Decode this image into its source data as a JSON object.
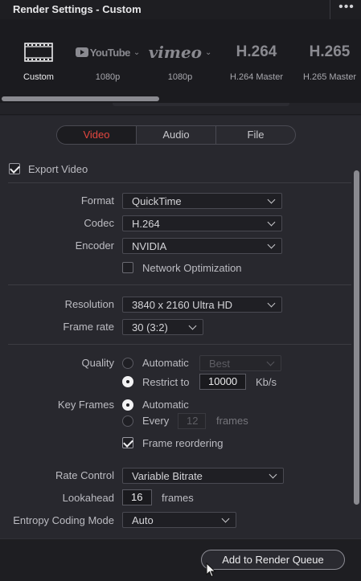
{
  "window": {
    "title": "Render Settings - Custom",
    "more_label": "•••"
  },
  "presets": [
    {
      "name": "Custom",
      "label": "Custom",
      "icon": "film-strip-icon",
      "active": true
    },
    {
      "name": "youtube",
      "label": "1080p",
      "logo": "YouTube",
      "icon": "youtube-logo"
    },
    {
      "name": "vimeo",
      "label": "1080p",
      "logo": "vimeo",
      "icon": "vimeo-logo"
    },
    {
      "name": "h264",
      "label": "H.264 Master",
      "logo": "H.264"
    },
    {
      "name": "h265",
      "label": "H.265 Master",
      "logo": "H.265"
    }
  ],
  "tabs": [
    "Video",
    "Audio",
    "File"
  ],
  "export_video": {
    "label": "Export Video",
    "checked": true
  },
  "format": {
    "label": "Format",
    "value": "QuickTime"
  },
  "codec": {
    "label": "Codec",
    "value": "H.264"
  },
  "encoder": {
    "label": "Encoder",
    "value": "NVIDIA"
  },
  "network_opt": {
    "label": "Network Optimization",
    "checked": false
  },
  "resolution": {
    "label": "Resolution",
    "value": "3840 x 2160 Ultra HD"
  },
  "frame_rate": {
    "label": "Frame rate",
    "value": "30 (3:2)"
  },
  "quality": {
    "label": "Quality",
    "automatic_label": "Automatic",
    "automatic_value": "Best",
    "restrict_label": "Restrict to",
    "restrict_value": "10000",
    "unit": "Kb/s"
  },
  "key_frames": {
    "label": "Key Frames",
    "automatic_label": "Automatic",
    "every_label": "Every",
    "every_value": "12",
    "every_unit": "frames",
    "reorder_label": "Frame reordering",
    "reorder_checked": true
  },
  "rate_control": {
    "label": "Rate Control",
    "value": "Variable Bitrate"
  },
  "lookahead": {
    "label": "Lookahead",
    "value": "16",
    "unit": "frames"
  },
  "entropy": {
    "label": "Entropy Coding Mode",
    "value": "Auto"
  },
  "footer": {
    "add_button": "Add to Render Queue"
  },
  "colors": {
    "accent_tab": "#e4473f",
    "panel_bg": "#28282e",
    "preset_bg": "#1b1b1f"
  }
}
